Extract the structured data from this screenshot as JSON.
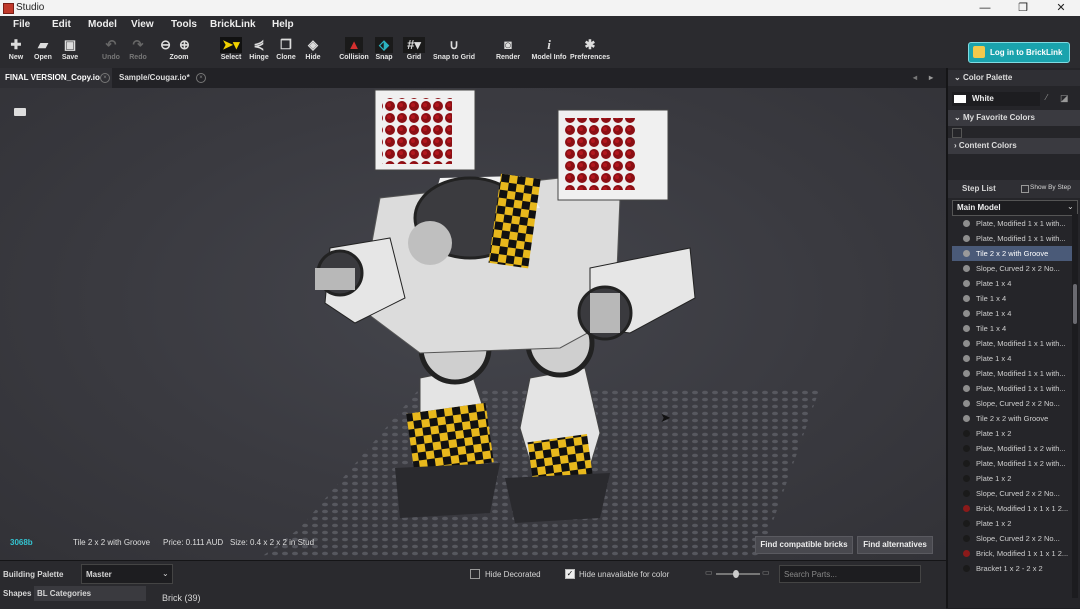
{
  "window": {
    "title": "Studio",
    "controls": [
      "—",
      "❐",
      "✕"
    ]
  },
  "menu": [
    "File",
    "Edit",
    "Model",
    "View",
    "Tools",
    "BrickLink",
    "Help"
  ],
  "toolbar": {
    "new": "New",
    "open": "Open",
    "save": "Save",
    "undo": "Undo",
    "redo": "Redo",
    "zoom": "Zoom",
    "select": "Select",
    "hinge": "Hinge",
    "clone": "Clone",
    "hide": "Hide",
    "collision": "Collision",
    "snap": "Snap",
    "grid": "Grid",
    "snap_to_grid": "Snap to Grid",
    "render": "Render",
    "model_info": "Model Info",
    "preferences": "Preferences",
    "login": "Log in to BrickLink"
  },
  "tabs": [
    {
      "label": "FINAL VERSION_Copy.io",
      "active": true
    },
    {
      "label": "Sample/Cougar.io*",
      "active": false
    }
  ],
  "tab_nav": [
    "◂",
    "▸"
  ],
  "selection_info": {
    "part_id": "3068b",
    "part_name": "Tile 2 x 2 with Groove",
    "price": "Price: 0.111 AUD",
    "size": "Size: 0.4 x 2 x 2 in Stud"
  },
  "actions": {
    "find_compatible": "Find compatible bricks",
    "find_alternatives": "Find alternatives"
  },
  "bottom": {
    "building_palette": "Building Palette",
    "palette_value": "Master",
    "hide_decorated": "Hide Decorated",
    "hide_decorated_checked": false,
    "hide_unavailable": "Hide unavailable for color",
    "hide_unavailable_checked": true,
    "search_placeholder": "Search Parts...",
    "zoom_slider_level": 0.45,
    "shapes_tab": "Shapes",
    "bl_categories": "BL Categories",
    "brick_header": "Brick (39)"
  },
  "color_palette": {
    "title": "Color Palette",
    "current_color": "White",
    "current_hex": "#ffffff",
    "favorites": "My Favorite Colors",
    "content": "Content Colors"
  },
  "step_list": {
    "title": "Step List",
    "show_by_step": "Show By Step",
    "model": "Main Model",
    "items": [
      {
        "label": "Plate, Modified 1 x 1 with...",
        "color": "#8e8e8e",
        "selected": false
      },
      {
        "label": "Plate, Modified 1 x 1 with...",
        "color": "#8e8e8e",
        "selected": false
      },
      {
        "label": "Tile 2 x 2 with Groove",
        "color": "#9a9a9a",
        "selected": true
      },
      {
        "label": "Slope, Curved 2 x 2 No...",
        "color": "#8e8e8e",
        "selected": false
      },
      {
        "label": "Plate 1 x 4",
        "color": "#8e8e8e",
        "selected": false
      },
      {
        "label": "Tile 1 x 4",
        "color": "#8e8e8e",
        "selected": false
      },
      {
        "label": "Plate 1 x 4",
        "color": "#8e8e8e",
        "selected": false
      },
      {
        "label": "Tile 1 x 4",
        "color": "#8e8e8e",
        "selected": false
      },
      {
        "label": "Plate, Modified 1 x 1 with...",
        "color": "#8e8e8e",
        "selected": false
      },
      {
        "label": "Plate 1 x 4",
        "color": "#8e8e8e",
        "selected": false
      },
      {
        "label": "Plate, Modified 1 x 1 with...",
        "color": "#8e8e8e",
        "selected": false
      },
      {
        "label": "Plate, Modified 1 x 1 with...",
        "color": "#8e8e8e",
        "selected": false
      },
      {
        "label": "Slope, Curved 2 x 2 No...",
        "color": "#8e8e8e",
        "selected": false
      },
      {
        "label": "Tile 2 x 2 with Groove",
        "color": "#8e8e8e",
        "selected": false
      },
      {
        "label": "Plate 1 x 2",
        "color": "#1a1a1a",
        "selected": false
      },
      {
        "label": "Plate, Modified 1 x 2 with...",
        "color": "#1a1a1a",
        "selected": false
      },
      {
        "label": "Plate, Modified 1 x 2 with...",
        "color": "#1a1a1a",
        "selected": false
      },
      {
        "label": "Plate 1 x 2",
        "color": "#1a1a1a",
        "selected": false
      },
      {
        "label": "Slope, Curved 2 x 2 No...",
        "color": "#1a1a1a",
        "selected": false
      },
      {
        "label": "Brick, Modified 1 x 1 x 1 2...",
        "color": "#8b1a1a",
        "selected": false
      },
      {
        "label": "Plate 1 x 2",
        "color": "#1a1a1a",
        "selected": false
      },
      {
        "label": "Slope, Curved 2 x 2 No...",
        "color": "#1a1a1a",
        "selected": false
      },
      {
        "label": "Brick, Modified 1 x 1 x 1 2...",
        "color": "#8b1a1a",
        "selected": false
      },
      {
        "label": "Bracket 1 x 2 - 2 x 2",
        "color": "#1a1a1a",
        "selected": false
      }
    ]
  },
  "colors": {
    "accent": "#1aa3ad",
    "selected_row": "#4a5a78",
    "collision": "#d4302f",
    "snap": "#2bb3c0"
  }
}
